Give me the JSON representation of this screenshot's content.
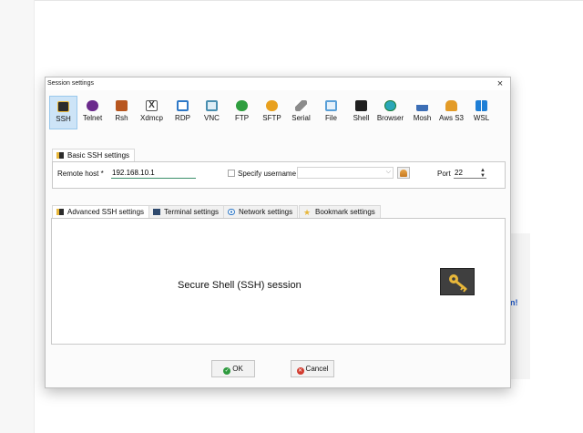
{
  "dialog": {
    "title": "Session settings",
    "close_label": "×"
  },
  "protocols": [
    {
      "label": "SSH",
      "icon": "ssh-icon",
      "color": "#2b2b2b",
      "selected": true
    },
    {
      "label": "Telnet",
      "icon": "telnet-icon",
      "color": "#6b2a8c"
    },
    {
      "label": "Rsh",
      "icon": "rsh-icon",
      "color": "#b8561f"
    },
    {
      "label": "Xdmcp",
      "icon": "xdmcp-icon",
      "color": "#555555"
    },
    {
      "label": "RDP",
      "icon": "rdp-icon",
      "color": "#2e78c7"
    },
    {
      "label": "VNC",
      "icon": "vnc-icon",
      "color": "#4a8fb0"
    },
    {
      "label": "FTP",
      "icon": "ftp-icon",
      "color": "#2f9e3f"
    },
    {
      "label": "SFTP",
      "icon": "sftp-icon",
      "color": "#e8a01e"
    },
    {
      "label": "Serial",
      "icon": "serial-icon",
      "color": "#8c8c8c"
    },
    {
      "label": "File",
      "icon": "file-icon",
      "color": "#5aa0d8"
    },
    {
      "label": "Shell",
      "icon": "shell-icon",
      "color": "#1f1f1f"
    },
    {
      "label": "Browser",
      "icon": "browser-icon",
      "color": "#2aa7b8"
    },
    {
      "label": "Mosh",
      "icon": "mosh-icon",
      "color": "#3d6fb6"
    },
    {
      "label": "Aws S3",
      "icon": "aws-s3-icon",
      "color": "#e39b27"
    },
    {
      "label": "WSL",
      "icon": "wsl-icon",
      "color": "#1e7fd6"
    }
  ],
  "basic": {
    "tab_label": "Basic SSH settings",
    "remote_host_label": "Remote host *",
    "remote_host_value": "192.168.10.1",
    "specify_username_label": "Specify username",
    "username_value": "",
    "port_label": "Port",
    "port_value": "22"
  },
  "tabs": [
    {
      "label": "Advanced SSH settings",
      "icon": "ssh-settings-icon"
    },
    {
      "label": "Terminal settings",
      "icon": "terminal-icon"
    },
    {
      "label": "Network settings",
      "icon": "network-icon"
    },
    {
      "label": "Bookmark settings",
      "icon": "star-icon"
    }
  ],
  "session": {
    "title": "Secure Shell (SSH) session",
    "icon": "key-icon"
  },
  "buttons": {
    "ok_label": "OK",
    "cancel_label": "Cancel"
  },
  "colors": {
    "selected_bg": "#cde4f7",
    "ok_green": "#2e9a3e",
    "cancel_red": "#d23b2f",
    "key_gold": "#e8b73a"
  },
  "background": {
    "partial_text": "n!"
  }
}
